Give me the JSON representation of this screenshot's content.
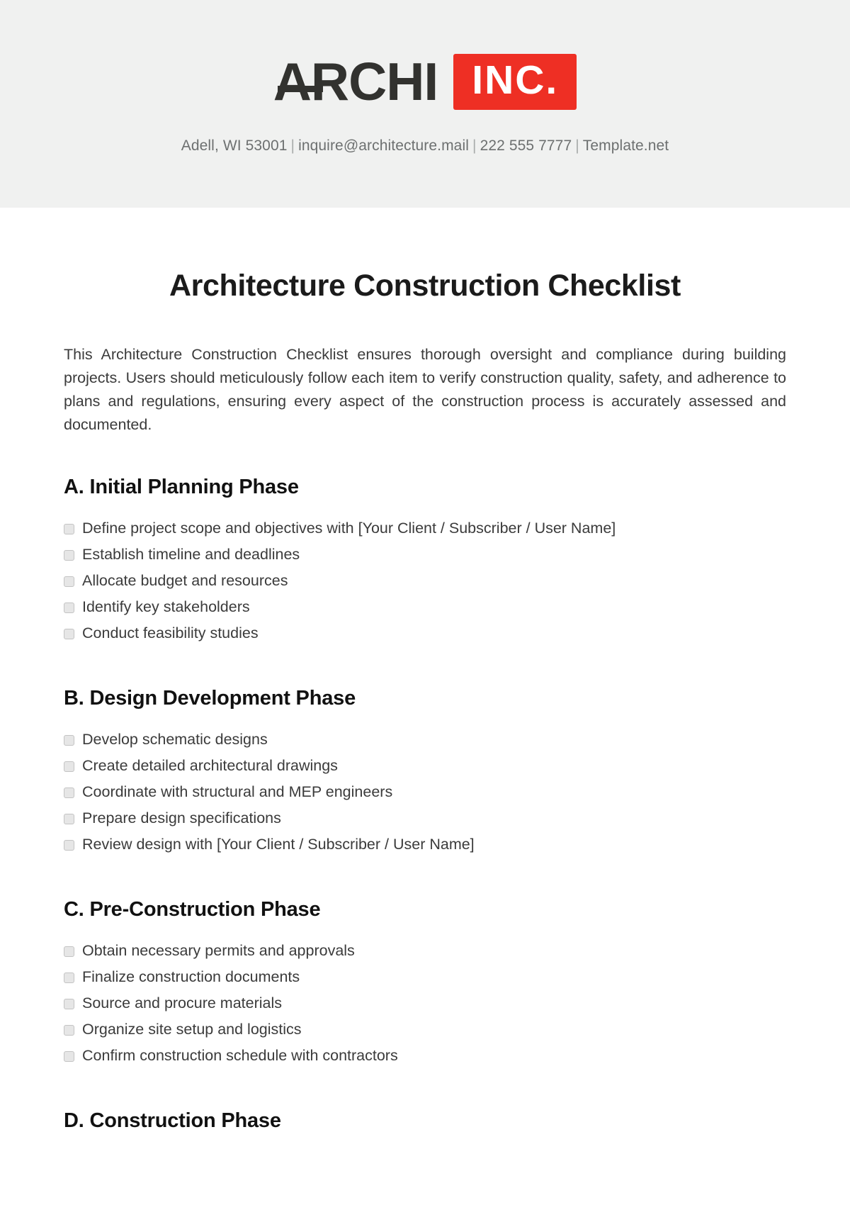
{
  "letterhead": {
    "logo": {
      "name_part_1": "A",
      "name_part_2": "RCHI",
      "badge": "INC.",
      "badge_color": "#ee2f24",
      "wordmark_color": "#32322f"
    },
    "contact": {
      "address": "Adell, WI 53001",
      "email": "inquire@architecture.mail",
      "phone": "222 555 7777",
      "website": "Template.net",
      "separator": "|"
    }
  },
  "document": {
    "title": "Architecture Construction Checklist",
    "intro": "This Architecture Construction Checklist ensures thorough oversight and compliance during building projects. Users should meticulously follow each item to verify construction quality, safety, and adherence to plans and regulations, ensuring every aspect of the construction process is accurately assessed and documented.",
    "sections": [
      {
        "heading": "A. Initial Planning Phase",
        "items": [
          "Define project scope and objectives with [Your Client / Subscriber / User Name]",
          "Establish timeline and deadlines",
          "Allocate budget and resources",
          "Identify key stakeholders",
          "Conduct feasibility studies"
        ]
      },
      {
        "heading": "B. Design Development Phase",
        "items": [
          "Develop schematic designs",
          "Create detailed architectural drawings",
          "Coordinate with structural and MEP engineers",
          "Prepare design specifications",
          "Review design with [Your Client / Subscriber / User Name]"
        ]
      },
      {
        "heading": "C. Pre-Construction Phase",
        "items": [
          "Obtain necessary permits and approvals",
          "Finalize construction documents",
          "Source and procure materials",
          "Organize site setup and logistics",
          "Confirm construction schedule with contractors"
        ]
      },
      {
        "heading": "D. Construction Phase",
        "items": []
      }
    ]
  }
}
